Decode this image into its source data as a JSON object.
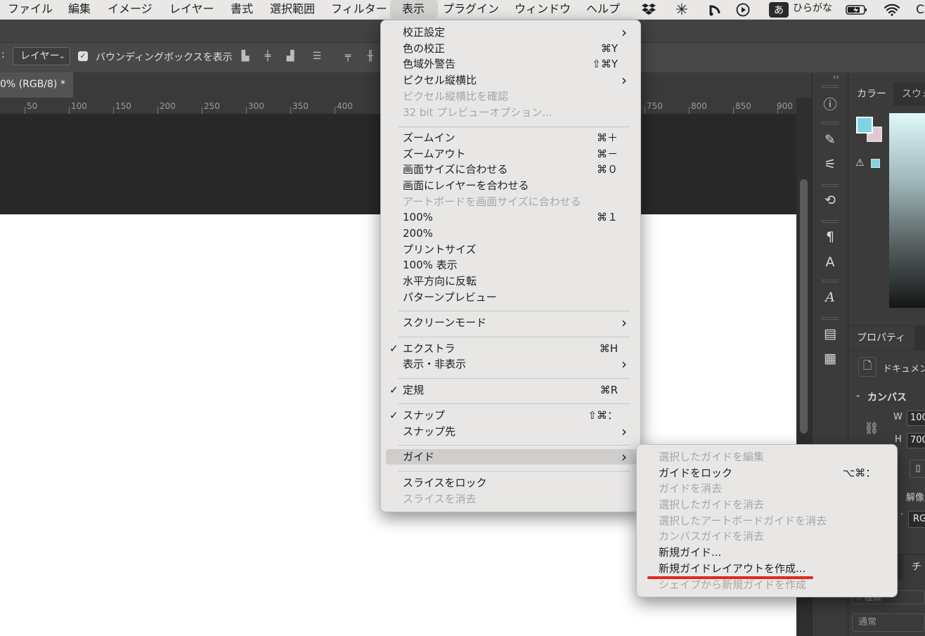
{
  "menubar": {
    "items": [
      "ファイル",
      "編集",
      "イメージ",
      "レイヤー",
      "書式",
      "選択範囲",
      "フィルター",
      "表示",
      "プラグイン",
      "ウィンドウ",
      "ヘルプ"
    ],
    "active": "表示",
    "ime_icon": "あ",
    "ime_label": "ひらがな",
    "tray_icons": [
      "dropbox-icon",
      "sparkle-icon",
      "relay-icon",
      "play-circle-icon",
      "battery-icon",
      "wifi-icon",
      "control-center-icon"
    ]
  },
  "options_bar": {
    "colon": ":",
    "layer_select": "レイヤー",
    "bbox_label": "バウンディングボックスを表示",
    "checked": true
  },
  "doc_tab": "0% (RGB/8) *",
  "ruler": [
    "50",
    "100",
    "150",
    "200",
    "250",
    "300",
    "350",
    "400",
    "750",
    "800",
    "850",
    "900"
  ],
  "view_menu": {
    "items": [
      {
        "label": "校正設定",
        "shortcut": "",
        "submenu": true,
        "disabled": false,
        "checked": false
      },
      {
        "label": "色の校正",
        "shortcut": "⌘Y",
        "submenu": false,
        "disabled": false,
        "checked": false
      },
      {
        "label": "色域外警告",
        "shortcut": "⇧⌘Y",
        "submenu": false,
        "disabled": false,
        "checked": false
      },
      {
        "label": "ピクセル縦横比",
        "shortcut": "",
        "submenu": true,
        "disabled": false,
        "checked": false
      },
      {
        "label": "ピクセル縦横比を確認",
        "shortcut": "",
        "submenu": false,
        "disabled": true,
        "checked": false
      },
      {
        "label": "32 bit プレビューオプション...",
        "shortcut": "",
        "submenu": false,
        "disabled": true,
        "checked": false
      },
      {
        "label": "ズームイン",
        "shortcut": "⌘＋",
        "submenu": false,
        "disabled": false,
        "checked": false
      },
      {
        "label": "ズームアウト",
        "shortcut": "⌘－",
        "submenu": false,
        "disabled": false,
        "checked": false
      },
      {
        "label": "画面サイズに合わせる",
        "shortcut": "⌘０",
        "submenu": false,
        "disabled": false,
        "checked": false
      },
      {
        "label": "画面にレイヤーを合わせる",
        "shortcut": "",
        "submenu": false,
        "disabled": false,
        "checked": false
      },
      {
        "label": "アートボードを画面サイズに合わせる",
        "shortcut": "",
        "submenu": false,
        "disabled": true,
        "checked": false
      },
      {
        "label": "100%",
        "shortcut": "⌘１",
        "submenu": false,
        "disabled": false,
        "checked": false
      },
      {
        "label": "200%",
        "shortcut": "",
        "submenu": false,
        "disabled": false,
        "checked": false
      },
      {
        "label": "プリントサイズ",
        "shortcut": "",
        "submenu": false,
        "disabled": false,
        "checked": false
      },
      {
        "label": "100% 表示",
        "shortcut": "",
        "submenu": false,
        "disabled": false,
        "checked": false
      },
      {
        "label": "水平方向に反転",
        "shortcut": "",
        "submenu": false,
        "disabled": false,
        "checked": false
      },
      {
        "label": "パターンプレビュー",
        "shortcut": "",
        "submenu": false,
        "disabled": false,
        "checked": false
      },
      {
        "label": "スクリーンモード",
        "shortcut": "",
        "submenu": true,
        "disabled": false,
        "checked": false
      },
      {
        "label": "エクストラ",
        "shortcut": "⌘H",
        "submenu": false,
        "disabled": false,
        "checked": true
      },
      {
        "label": "表示・非表示",
        "shortcut": "",
        "submenu": true,
        "disabled": false,
        "checked": false
      },
      {
        "label": "定規",
        "shortcut": "⌘R",
        "submenu": false,
        "disabled": false,
        "checked": true
      },
      {
        "label": "スナップ",
        "shortcut": "⇧⌘：",
        "submenu": false,
        "disabled": false,
        "checked": true
      },
      {
        "label": "スナップ先",
        "shortcut": "",
        "submenu": true,
        "disabled": false,
        "checked": false
      },
      {
        "label": "ガイド",
        "shortcut": "",
        "submenu": true,
        "disabled": false,
        "checked": false,
        "highlighted": true
      },
      {
        "label": "スライスをロック",
        "shortcut": "",
        "submenu": false,
        "disabled": false,
        "checked": false
      },
      {
        "label": "スライスを消去",
        "shortcut": "",
        "submenu": false,
        "disabled": true,
        "checked": false
      }
    ]
  },
  "guide_submenu": {
    "items": [
      {
        "label": "選択したガイドを編集",
        "shortcut": "",
        "disabled": true
      },
      {
        "label": "ガイドをロック",
        "shortcut": "⌥⌘：",
        "disabled": false
      },
      {
        "label": "ガイドを消去",
        "shortcut": "",
        "disabled": true
      },
      {
        "label": "選択したガイドを消去",
        "shortcut": "",
        "disabled": true
      },
      {
        "label": "選択したアートボードガイドを消去",
        "shortcut": "",
        "disabled": true
      },
      {
        "label": "カンバスガイドを消去",
        "shortcut": "",
        "disabled": true
      },
      {
        "label": "新規ガイド...",
        "shortcut": "",
        "disabled": false
      },
      {
        "label": "新規ガイドレイアウトを作成...",
        "shortcut": "",
        "disabled": false,
        "annotated": true
      },
      {
        "label": "シェイプから新規ガイドを作成",
        "shortcut": "",
        "disabled": true
      }
    ],
    "annotation_color": "#e3261d"
  },
  "panels": {
    "color_tab": "カラー",
    "swatch_tab": "スウォ",
    "properties_tab": "プロパティ",
    "doc_label": "ドキュメン",
    "canvas_header": "カンバス",
    "w_label": "W",
    "w_value": "100",
    "h_label": "H",
    "h_value": "700",
    "resolution_label": "解像",
    "mode_value": "RG",
    "channel_tab": "チ",
    "search_placeholder": "種類",
    "blend_mode": "通常",
    "fg_color": "#7fd4e3",
    "bg_color": "#e3c8d3"
  }
}
